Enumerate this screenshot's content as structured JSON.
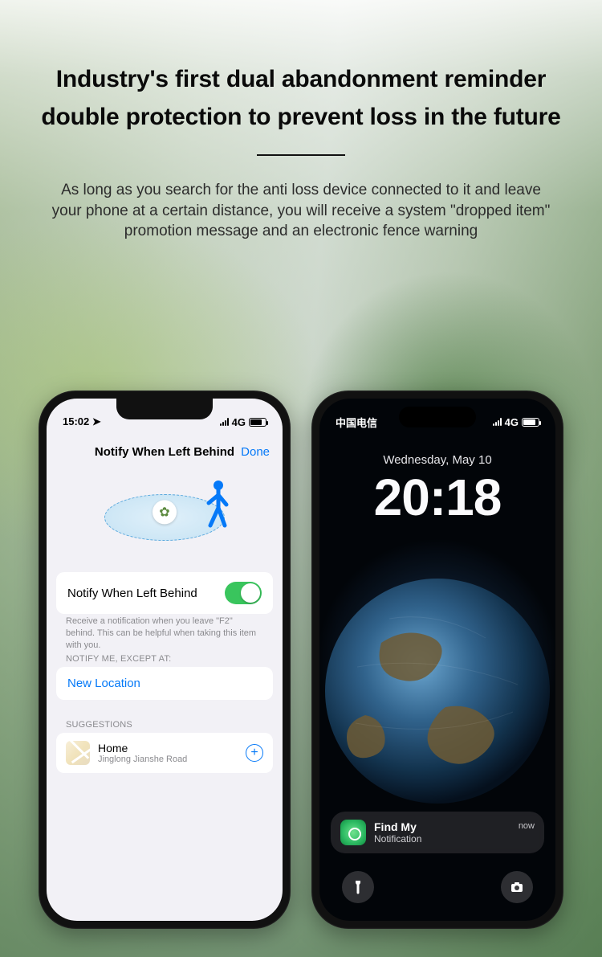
{
  "headline_line1": "Industry's first dual abandonment reminder",
  "headline_line2": "double protection to prevent loss in the future",
  "subhead": "As long as you search for the anti loss device connected to it and leave your phone at a certain distance, you will receive a system \"dropped item\" promotion message and an electronic fence warning",
  "phone1": {
    "status_time": "15:02",
    "status_net": "4G",
    "nav_title": "Notify When Left Behind",
    "nav_done": "Done",
    "toggle_label": "Notify When Left Behind",
    "helper_text": "Receive a notification when you leave \"F2\" behind. This can be helpful when taking this item with you.",
    "section_notify_except": "NOTIFY ME, EXCEPT AT:",
    "new_location": "New Location",
    "section_suggestions": "SUGGESTIONS",
    "suggestion_name": "Home",
    "suggestion_addr": "Jinglong Jianshe Road"
  },
  "phone2": {
    "status_carrier": "中国电信",
    "status_net": "4G",
    "date": "Wednesday, May 10",
    "time": "20:18",
    "notif_app": "Find My",
    "notif_body": "Notification",
    "notif_time": "now"
  }
}
